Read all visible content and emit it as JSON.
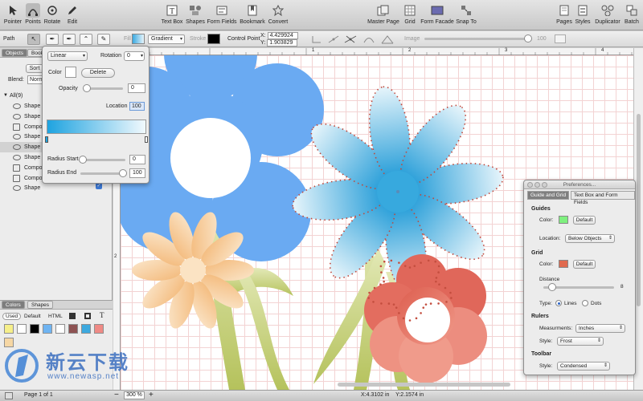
{
  "toolbar": {
    "left": [
      {
        "label": "Pointer",
        "icon": "pointer-icon"
      },
      {
        "label": "Points",
        "icon": "points-icon"
      },
      {
        "label": "Rotate",
        "icon": "rotate-icon"
      },
      {
        "label": "Edit",
        "icon": "pencil-icon"
      }
    ],
    "center": [
      {
        "label": "Text Box",
        "icon": "text-box-icon"
      },
      {
        "label": "Shapes",
        "icon": "shapes-icon"
      },
      {
        "label": "Form Fields",
        "icon": "form-fields-icon"
      },
      {
        "label": "Bookmark",
        "icon": "bookmark-icon"
      },
      {
        "label": "Convert",
        "icon": "convert-icon"
      }
    ],
    "right": [
      {
        "label": "Master Page",
        "icon": "master-page-icon"
      },
      {
        "label": "Grid",
        "icon": "grid-icon"
      },
      {
        "label": "Form Facade",
        "icon": "form-facade-icon"
      },
      {
        "label": "Snap To",
        "icon": "snap-to-icon"
      }
    ],
    "far_right": [
      {
        "label": "Pages",
        "icon": "pages-icon"
      },
      {
        "label": "Styles",
        "icon": "styles-icon"
      },
      {
        "label": "Duplicator",
        "icon": "duplicator-icon"
      },
      {
        "label": "Batch",
        "icon": "batch-icon"
      }
    ]
  },
  "pathbar": {
    "label": "Path",
    "fill_label": "Fill",
    "fill_type": "Gradient",
    "stroke_label": "Stroke",
    "control_point_label": "Control Point",
    "x_label": "X:",
    "x_value": "4.429924",
    "y_label": "Y:",
    "y_value": "1.903829",
    "image_label": "Image",
    "image_value": "100"
  },
  "sidebar": {
    "tabs": [
      "Objects",
      "Book"
    ],
    "sort_label": "Sort",
    "blend_label": "Blend:",
    "blend_value": "Norm",
    "all_label": "All(9)",
    "objects": [
      {
        "label": "Shape",
        "type": "shape"
      },
      {
        "label": "Shape",
        "type": "shape"
      },
      {
        "label": "Compo",
        "type": "compound"
      },
      {
        "label": "Shape",
        "type": "shape"
      },
      {
        "label": "Shape",
        "type": "shape",
        "selected": true
      },
      {
        "label": "Shape",
        "type": "shape"
      },
      {
        "label": "Compo",
        "type": "compound"
      },
      {
        "label": "Compo",
        "type": "compound"
      },
      {
        "label": "Shape",
        "type": "shape"
      }
    ],
    "colors_tabs": [
      "Colors",
      "Shapes"
    ],
    "colors_sub": [
      "Used",
      "Default",
      "HTML"
    ],
    "swatch_colors": [
      "#f6ef8a",
      "#ffffff",
      "#000000",
      "#6fb4f2",
      "#ffffff",
      "#8d5252",
      "#3da9df",
      "#ef8a85",
      "#f6d7a4"
    ]
  },
  "popover": {
    "type_value": "Linear",
    "rotation_label": "Rotation",
    "rotation_value": "0",
    "color_label": "Color",
    "delete_label": "Delete",
    "opacity_label": "Opacity",
    "opacity_value": "0",
    "location_label": "Location",
    "location_value": "100",
    "radius_start_label": "Radius Start",
    "radius_start_value": "0",
    "radius_end_label": "Radius End",
    "radius_end_value": "100"
  },
  "prefs": {
    "title": "Preferences...",
    "tabs": [
      "Guide and Grid",
      "Text Box and Form Fields"
    ],
    "guides_label": "Guides",
    "guides_color_label": "Color:",
    "guides_default": "Default",
    "location_label": "Location:",
    "location_value": "Below Objects",
    "grid_label": "Grid",
    "grid_color_label": "Color:",
    "grid_default": "Default",
    "distance_label": "Distance",
    "distance_value": "8",
    "type_label": "Type:",
    "type_lines": "Lines",
    "type_dots": "Dots",
    "rulers_label": "Rulers",
    "measurments_label": "Measurments:",
    "measurments_value": "Inches",
    "rulers_style_label": "Style:",
    "rulers_style_value": "Frost",
    "toolbar_label": "Toolbar",
    "toolbar_style_label": "Style:",
    "toolbar_style_value": "Condensed",
    "guides_color": "#7ff07f",
    "grid_color": "#e06a4f"
  },
  "status": {
    "page_label": "Page 1 of 1",
    "zoom_value": "300 %",
    "coords": "X:4.3102 in    Y:2.1574 in"
  },
  "watermark": {
    "brand": "新云下载",
    "url": "www.newasp.net"
  },
  "ruler": {
    "marks": [
      "1",
      "2",
      "3",
      "4"
    ],
    "left_mark": "2"
  },
  "colors": {
    "blue_flower": "#6aaaf0",
    "peach_flower": "#f5c98e",
    "teal_flower": "#35a8dd",
    "red_flower": "#e2675a",
    "stem": "#b6c468"
  }
}
